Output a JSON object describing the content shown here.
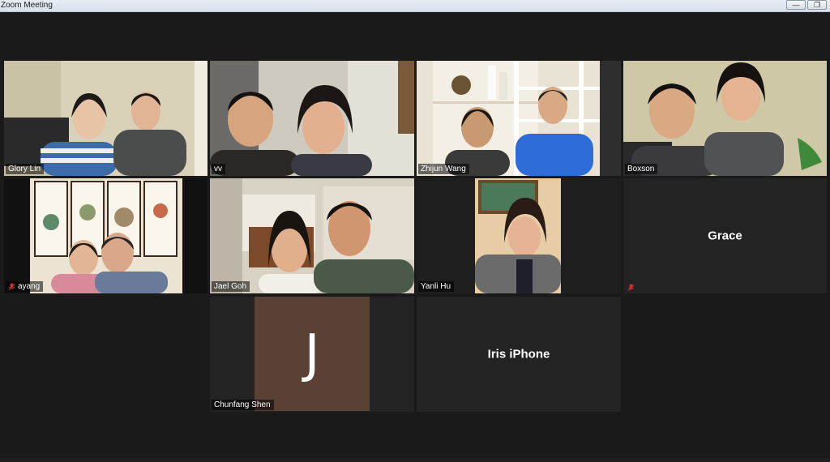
{
  "window": {
    "title": "Zoom Meeting",
    "buttons": {
      "minimize": "—",
      "restore": "❐"
    }
  },
  "participants": [
    {
      "name": "Glory Lin",
      "muted": false,
      "video": true,
      "active": false
    },
    {
      "name": "vv",
      "muted": false,
      "video": true,
      "active": false
    },
    {
      "name": "Zhijun Wang",
      "muted": false,
      "video": true,
      "active": false
    },
    {
      "name": "Boxson",
      "muted": false,
      "video": true,
      "active": false
    },
    {
      "name": "ayang",
      "muted": true,
      "video": true,
      "active": false
    },
    {
      "name": "Jael Goh",
      "muted": false,
      "video": true,
      "active": true
    },
    {
      "name": "Yanli Hu",
      "muted": false,
      "video": true,
      "active": false
    },
    {
      "name": "Grace",
      "muted": true,
      "video": false,
      "active": false
    },
    {
      "name": "Chunfang Shen",
      "muted": false,
      "video": false,
      "initial": "J",
      "active": false
    },
    {
      "name": "Iris iPhone",
      "muted": false,
      "video": false,
      "active": false
    }
  ],
  "colors": {
    "active_border": "#b9e34c",
    "muted_icon": "#e02b2b",
    "avatar_bg": "#5a4035"
  }
}
